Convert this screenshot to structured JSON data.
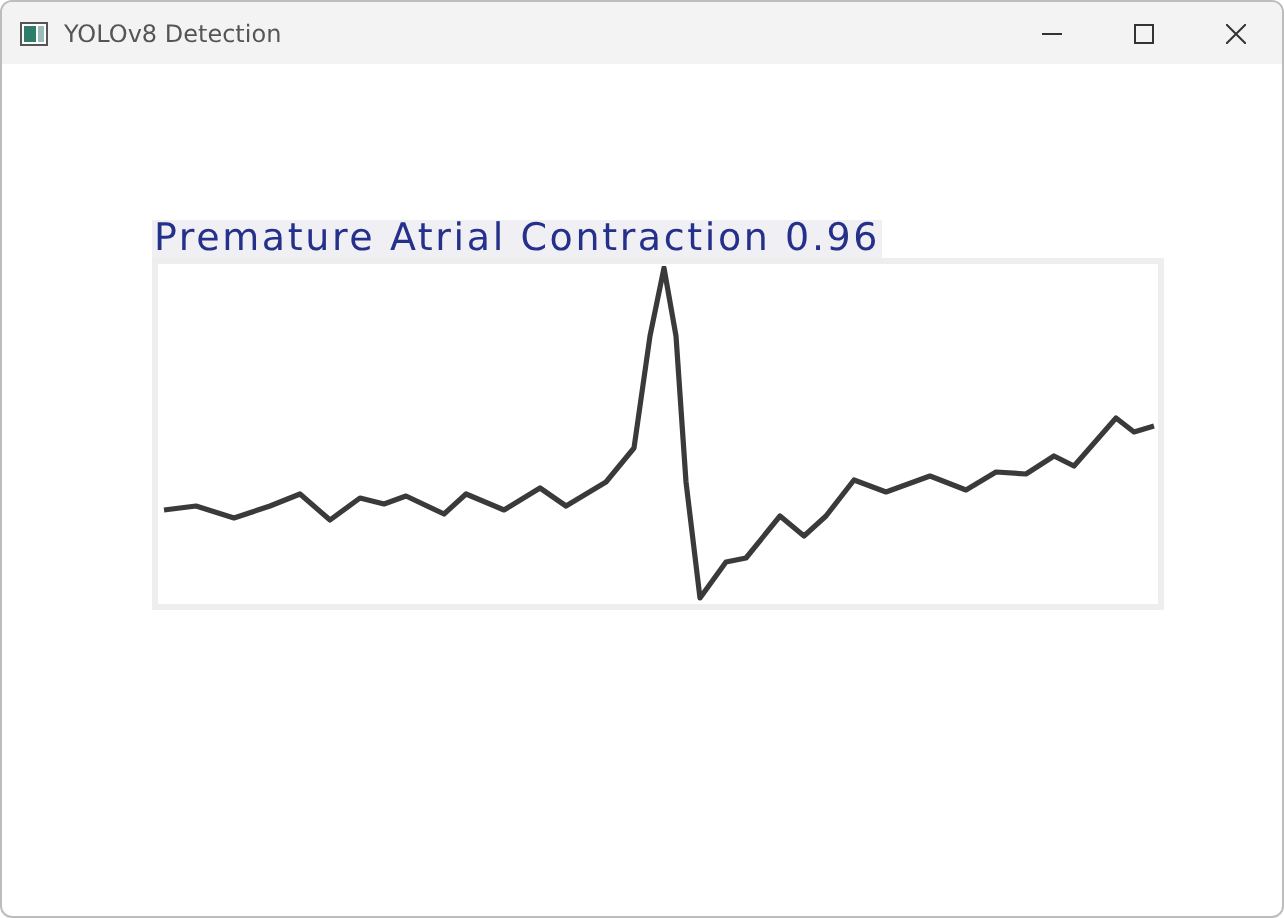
{
  "window": {
    "title": "YOLOv8 Detection"
  },
  "detection": {
    "label": "Premature Atrial Contraction 0.96"
  }
}
